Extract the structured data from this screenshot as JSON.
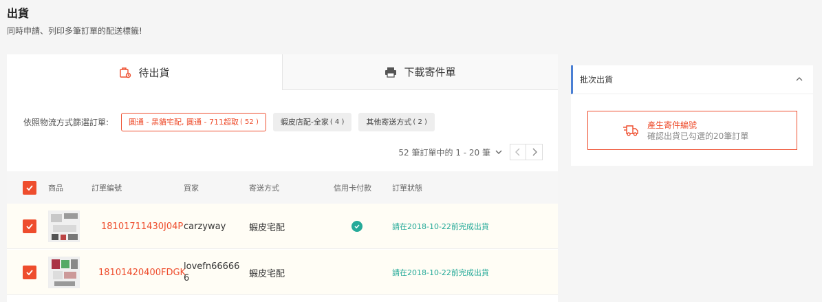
{
  "page": {
    "title": "出貨",
    "subtitle": "同時申請、列印多筆訂單的配送標籤!"
  },
  "tabs": [
    {
      "label": "待出貨",
      "icon": "package-icon",
      "active": true
    },
    {
      "label": "下載寄件單",
      "icon": "printer-icon",
      "active": false
    }
  ],
  "filter": {
    "label": "依照物流方式篩選訂單:",
    "options": [
      {
        "label": "圓通 - 黑貓宅配, 圓通 - 711超取",
        "count": "( 52 )",
        "active": true
      },
      {
        "label": "蝦皮店配-全家",
        "count": "( 4 )",
        "active": false
      },
      {
        "label": "其他寄送方式",
        "count": "( 2 )",
        "active": false
      }
    ]
  },
  "pager": {
    "text": "52 筆訂單中的 1 - 20 筆"
  },
  "table": {
    "headers": [
      "商品",
      "訂單編號",
      "買家",
      "寄送方式",
      "信用卡付款",
      "訂單狀態"
    ],
    "rows": [
      {
        "order_id": "18101711430J04P",
        "buyer": "carzyway",
        "shipping": "蝦皮宅配",
        "credit_card": true,
        "status": "請在2018-10-22前完成出貨",
        "checked": true
      },
      {
        "order_id": "18101420400FDGK",
        "buyer": "lovefn66666\n6",
        "shipping": "蝦皮宅配",
        "credit_card": false,
        "status": "請在2018-10-22前完成出貨",
        "checked": true
      }
    ]
  },
  "batch": {
    "title": "批次出貨",
    "button_title": "產生寄件編號",
    "button_sub": "確認出貨已勾選的20筆訂單"
  },
  "colors": {
    "accent": "#ee4d2d",
    "success": "#26aa99",
    "side_bar": "#4a7fd4"
  }
}
